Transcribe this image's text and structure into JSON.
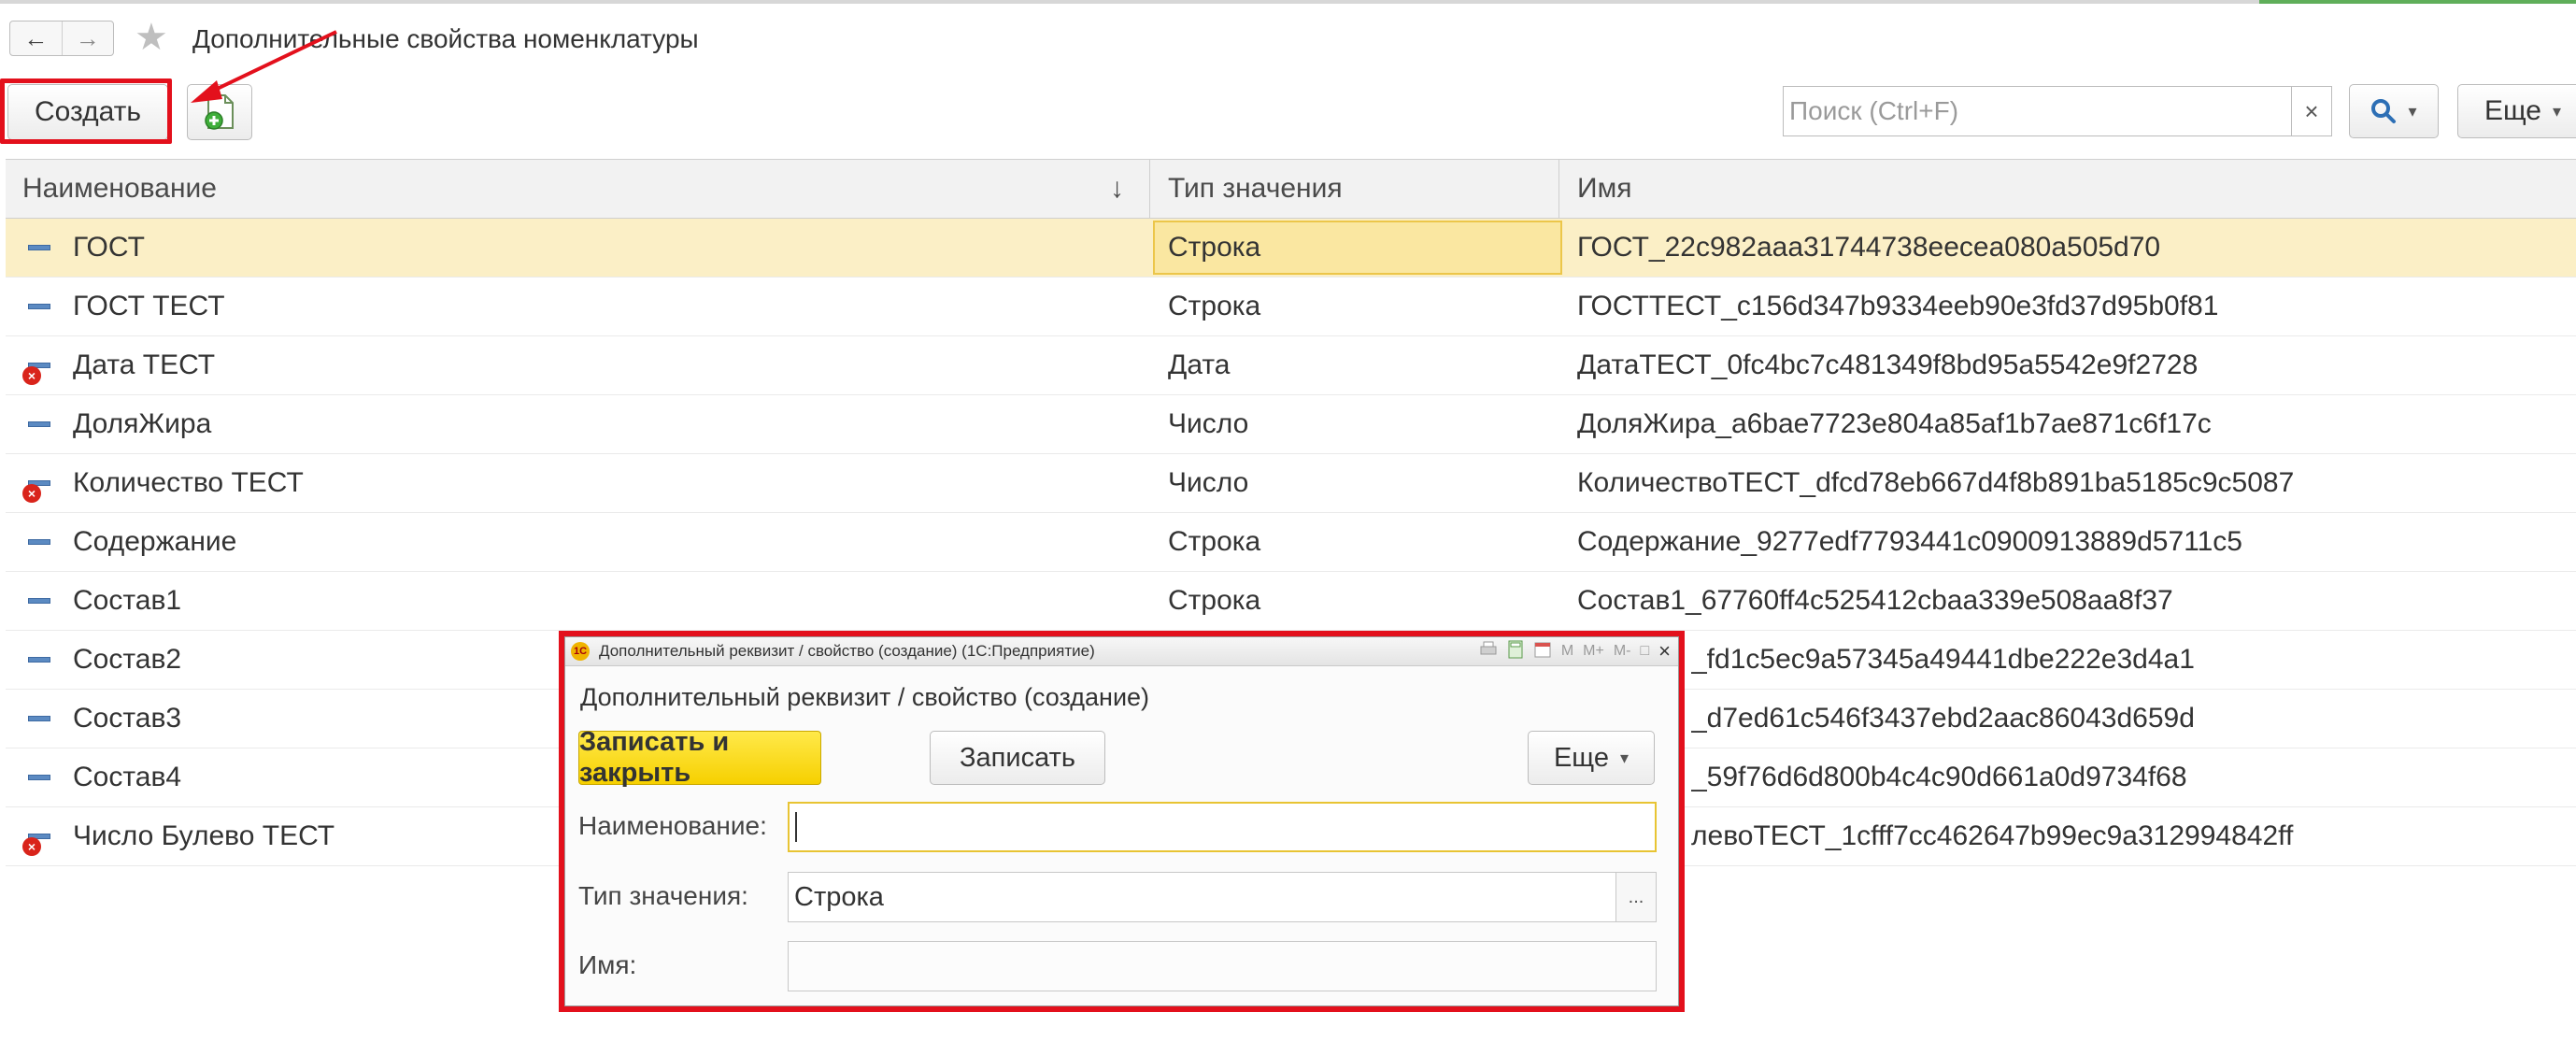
{
  "page": {
    "title": "Дополнительные свойства номенклатуры",
    "nav": {
      "back_icon": "←",
      "forward_icon": "→",
      "star_icon": "★"
    }
  },
  "toolbar": {
    "create_label": "Создать",
    "copy_icon": "copy-add-icon",
    "search_placeholder": "Поиск (Ctrl+F)",
    "search_clear": "×",
    "search_icon": "magnifier-icon",
    "more_label": "Еще",
    "caret": "▾"
  },
  "table": {
    "columns": [
      "Наименование",
      "Тип значения",
      "Имя"
    ],
    "sort_indicator": "↓",
    "rows": [
      {
        "name": "ГОСТ",
        "type": "Строка",
        "id": "ГОСТ_22c982aaa31744738eecea080a505d70",
        "deleted": false,
        "selected": true
      },
      {
        "name": "ГОСТ ТЕСТ",
        "type": "Строка",
        "id": "ГОСТТЕСТ_c156d347b9334eeb90e3fd37d95b0f81",
        "deleted": false,
        "selected": false
      },
      {
        "name": "Дата ТЕСТ",
        "type": "Дата",
        "id": "ДатаТЕСТ_0fc4bc7c481349f8bd95a5542e9f2728",
        "deleted": true,
        "selected": false
      },
      {
        "name": "ДоляЖира",
        "type": "Число",
        "id": "ДоляЖира_a6bae7723e804a85af1b7ae871c6f17c",
        "deleted": false,
        "selected": false
      },
      {
        "name": "Количество ТЕСТ",
        "type": "Число",
        "id": "КоличествоТЕСТ_dfcd78eb667d4f8b891ba5185c9c5087",
        "deleted": true,
        "selected": false
      },
      {
        "name": "Содержание",
        "type": "Строка",
        "id": "Содержание_9277edf7793441c0900913889d5711c5",
        "deleted": false,
        "selected": false
      },
      {
        "name": "Состав1",
        "type": "Строка",
        "id": "Состав1_67760ff4c525412cbaa339e508aa8f37",
        "deleted": false,
        "selected": false
      },
      {
        "name": "Состав2",
        "type": "",
        "id": "_fd1c5ec9a57345a49441dbe222e3d4a1",
        "deleted": false,
        "selected": false
      },
      {
        "name": "Состав3",
        "type": "",
        "id": "_d7ed61c546f3437ebd2aac86043d659d",
        "deleted": false,
        "selected": false
      },
      {
        "name": "Состав4",
        "type": "",
        "id": "_59f76d6d800b4c4c90d661a0d9734f68",
        "deleted": false,
        "selected": false
      },
      {
        "name": "Число Булево ТЕСТ",
        "type": "",
        "id": "левоТЕСТ_1cfff7cc462647b99ec9a312994842ff",
        "deleted": true,
        "selected": false
      }
    ]
  },
  "dialog": {
    "window_title": "Дополнительный реквизит / свойство (создание)  (1С:Предприятие)",
    "logo_text": "1С",
    "tools": [
      "M",
      "M+",
      "M-",
      "□",
      "×"
    ],
    "heading": "Дополнительный реквизит / свойство (создание)",
    "save_close_label": "Записать и закрыть",
    "save_label": "Записать",
    "more_label": "Еще",
    "fields": {
      "name_label": "Наименование:",
      "name_value": "",
      "type_label": "Тип значения:",
      "type_value": "Строка",
      "type_pick": "...",
      "id_label": "Имя:",
      "id_value": ""
    }
  },
  "colors": {
    "highlight_red": "#e3101c",
    "selected_row": "#fbefc6",
    "primary_button": "#f6d000"
  }
}
